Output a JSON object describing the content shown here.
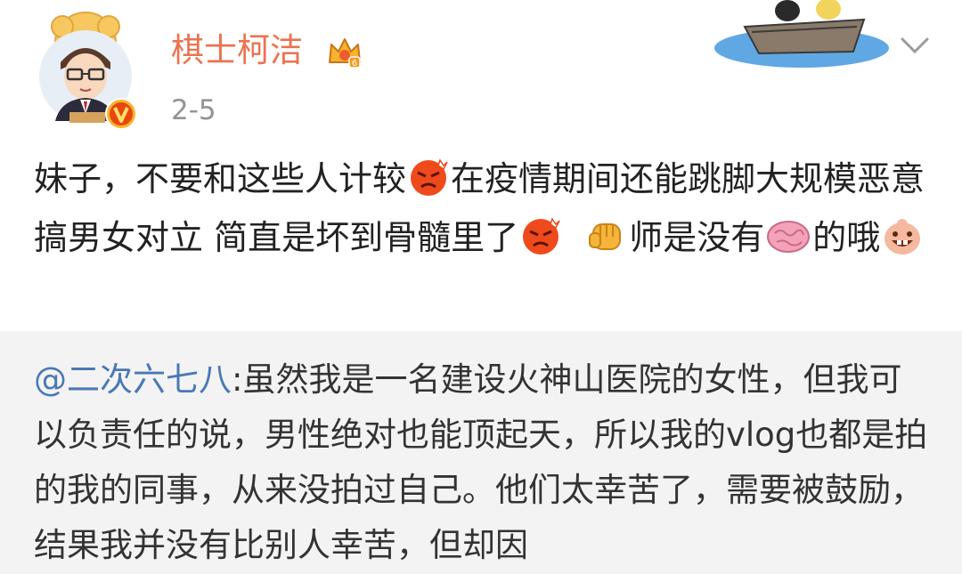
{
  "post": {
    "username": "棋士柯洁",
    "date": "2-5",
    "text_parts": [
      "妹子，不要和这些人计较",
      "在疫情期间还能跳脚大规模恶意搞男女对立 简直是坏到骨髓里了",
      "师是没有",
      "的哦"
    ],
    "emoji": [
      "angry-emoji",
      "fist-emoji",
      "brain-emoji",
      "grin-emoji"
    ]
  },
  "quote": {
    "mention": "@二次六七八",
    "text": ":虽然我是一名建设火神山医院的女性，但我可以负责任的说，男性绝对也能顶起天，所以我的vlog也都是拍的我的同事，从来没拍过自己。他们太幸苦了，需要被鼓励，结果我并没有比别人幸苦，但却因"
  },
  "colors": {
    "username": "#eb7350",
    "mention": "#4a78b4",
    "quote_bg": "#f3f3f3",
    "date": "#939393"
  }
}
